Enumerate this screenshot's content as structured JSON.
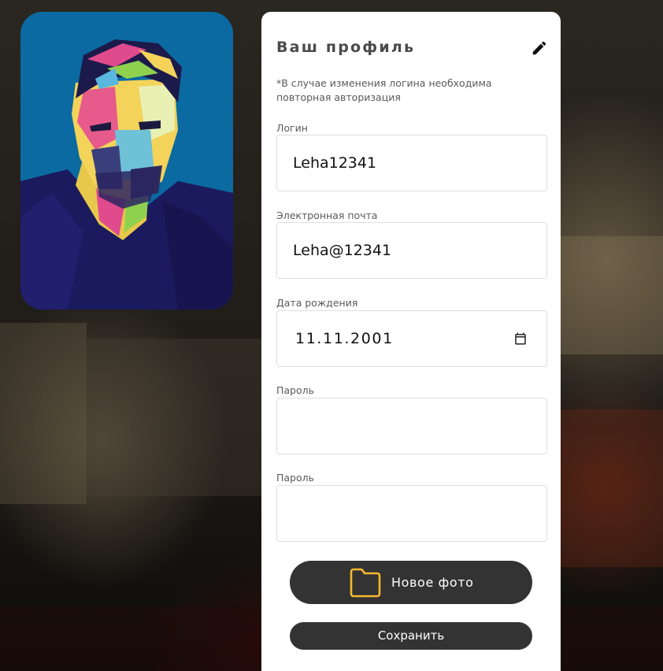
{
  "profile": {
    "title": "Ваш профиль",
    "edit_icon": "pencil-icon",
    "note": "*В случае изменения логина необходима повторная авторизация"
  },
  "fields": {
    "login": {
      "label": "Логин",
      "value": "Leha12341"
    },
    "email": {
      "label": "Электронная почта",
      "value": "Leha@12341"
    },
    "birthdate": {
      "label": "Дата рождения",
      "value": "11.11.2001",
      "icon": "calendar-icon"
    },
    "password": {
      "label": "Пароль",
      "value": ""
    },
    "password_confirm": {
      "label": "Пароль",
      "value": ""
    }
  },
  "buttons": {
    "new_photo": {
      "label": "Новое фото",
      "icon": "folder-icon"
    },
    "save": {
      "label": "Сохранить"
    }
  },
  "colors": {
    "card_bg": "#ffffff",
    "button_bg": "#333333",
    "folder_icon": "#f5b82e",
    "avatar_bg": "#0a6aa1"
  }
}
